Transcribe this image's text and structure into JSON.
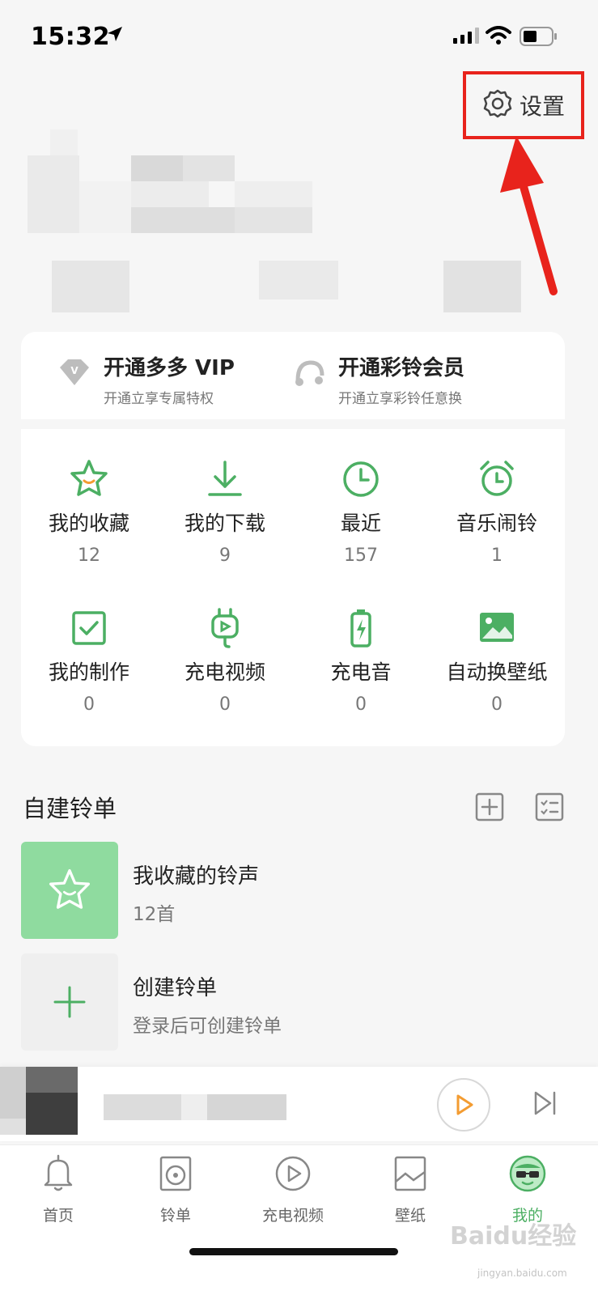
{
  "status": {
    "time": "15:32"
  },
  "header": {
    "settings_label": "设置"
  },
  "vip": [
    {
      "title": "开通多多 VIP",
      "subtitle": "开通立享专属特权",
      "icon": "diamond-icon"
    },
    {
      "title": "开通彩铃会员",
      "subtitle": "开通立享彩铃任意换",
      "icon": "ringtone-icon"
    }
  ],
  "grid": [
    {
      "label": "我的收藏",
      "count": "12",
      "icon": "star-icon"
    },
    {
      "label": "我的下载",
      "count": "9",
      "icon": "download-icon"
    },
    {
      "label": "最近",
      "count": "157",
      "icon": "clock-icon"
    },
    {
      "label": "音乐闹铃",
      "count": "1",
      "icon": "alarm-icon"
    },
    {
      "label": "我的制作",
      "count": "0",
      "icon": "check-box-icon"
    },
    {
      "label": "充电视频",
      "count": "0",
      "icon": "charge-video-icon"
    },
    {
      "label": "充电音",
      "count": "0",
      "icon": "battery-icon"
    },
    {
      "label": "自动换壁纸",
      "count": "0",
      "icon": "wallpaper-icon"
    }
  ],
  "playlists": {
    "title": "自建铃单",
    "items": [
      {
        "title": "我收藏的铃声",
        "subtitle": "12首"
      },
      {
        "title": "创建铃单",
        "subtitle": "登录后可创建铃单"
      }
    ]
  },
  "tabs": [
    {
      "label": "首页",
      "icon": "bell-icon"
    },
    {
      "label": "铃单",
      "icon": "disc-icon"
    },
    {
      "label": "充电视频",
      "icon": "play-circle-icon"
    },
    {
      "label": "壁纸",
      "icon": "image-icon"
    },
    {
      "label": "我的",
      "icon": "avatar-icon"
    }
  ],
  "watermark": {
    "text": "Baidu经验",
    "sub": "jingyan.baidu.com"
  },
  "colors": {
    "accent": "#4caf63",
    "highlight": "#e8231c",
    "play": "#f39c32"
  }
}
